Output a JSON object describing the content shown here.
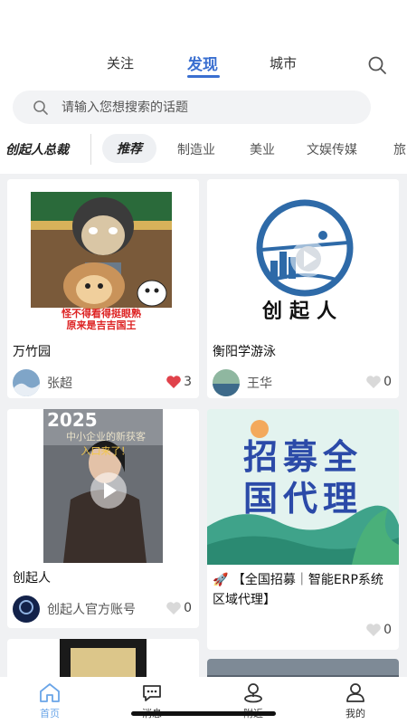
{
  "top_tabs": {
    "follow": "关注",
    "discover": "发现",
    "city": "城市"
  },
  "search": {
    "placeholder": "请输入您想搜索的话题"
  },
  "categories": {
    "fixed": "创起人总裁",
    "items": [
      "推荐",
      "制造业",
      "美业",
      "文娱传媒",
      "旅"
    ]
  },
  "feed": [
    {
      "title": "万竹园",
      "author": "张超",
      "likes": "3",
      "liked": true,
      "image_caption_line1": "怪不得看得挺眼熟",
      "image_caption_line2": "原来是吉吉国王"
    },
    {
      "title": "衡阳学游泳",
      "author": "王华",
      "likes": "0",
      "liked": false,
      "logo_text": "创起人"
    },
    {
      "title": "创起人",
      "author": "创起人官方账号",
      "likes": "0",
      "liked": false,
      "video_year": "2025",
      "video_headline": "中小企业的新获客",
      "video_subline": "入口来了！"
    },
    {
      "title": "🚀 【全国招募｜智能ERP系统区域代理】",
      "author": "",
      "likes": "0",
      "liked": false,
      "poster_line1": "招募全",
      "poster_line2": "国代理"
    }
  ],
  "bottom_nav": [
    {
      "label": "首页",
      "icon": "home-icon",
      "active": true
    },
    {
      "label": "消息",
      "icon": "message-icon",
      "active": false
    },
    {
      "label": "附近",
      "icon": "nearby-icon",
      "active": false
    },
    {
      "label": "我的",
      "icon": "profile-icon",
      "active": false
    }
  ],
  "colors": {
    "accent": "#3a6fd0",
    "like_red": "#e0424b",
    "nav_active": "#6aa5e8"
  }
}
